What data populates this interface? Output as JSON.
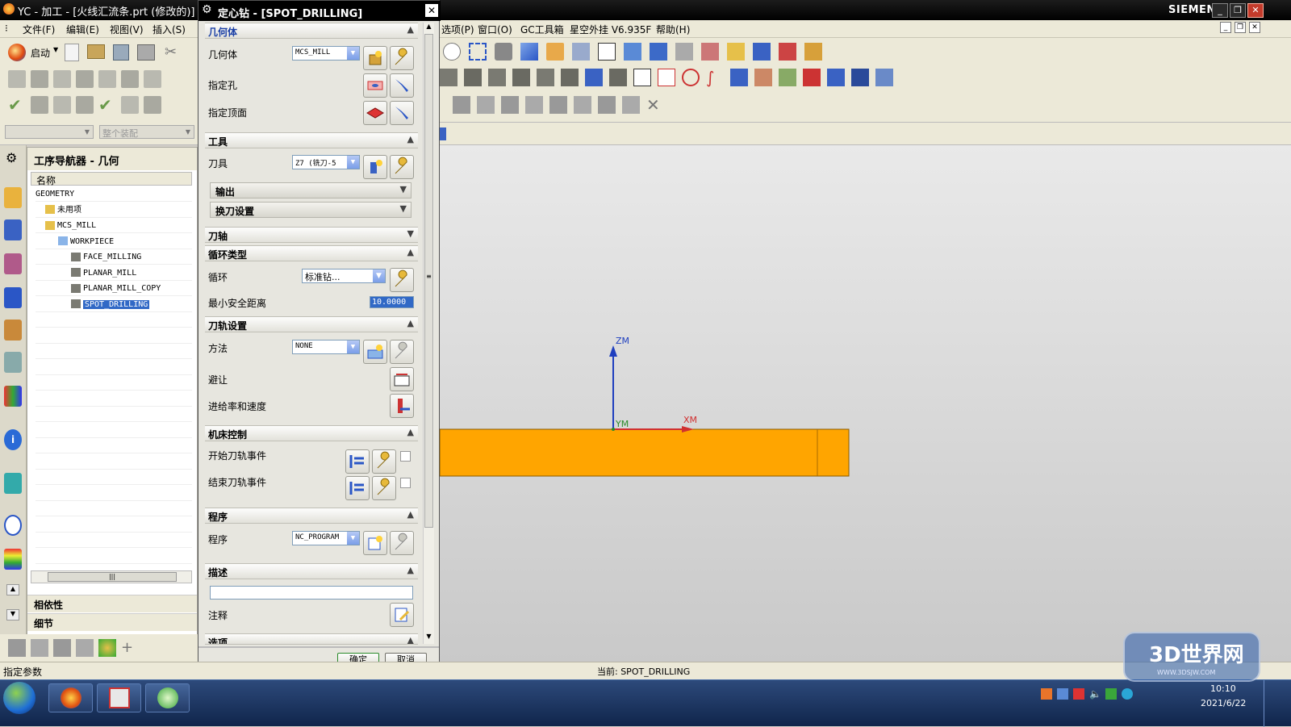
{
  "window": {
    "title": "YC - 加工 - [火线汇流条.prt (修改的)]",
    "brand": "SIEMENS"
  },
  "menu": {
    "left": [
      "文件(F)",
      "编辑(E)",
      "视图(V)",
      "插入(S)"
    ],
    "right": [
      "选项(P)",
      "窗口(O)",
      "GC工具箱",
      "星空外挂 V6.935F",
      "帮助(H)"
    ]
  },
  "toolbar": {
    "start_label": "启动",
    "assembly_placeholder": "整个装配"
  },
  "navigator": {
    "title": "工序导航器 - 几何",
    "column": "名称",
    "rows": [
      {
        "label": "GEOMETRY",
        "indent": 0
      },
      {
        "label": "未用项",
        "indent": 1
      },
      {
        "label": "MCS_MILL",
        "indent": 1
      },
      {
        "label": "WORKPIECE",
        "indent": 2
      },
      {
        "label": "FACE_MILLING",
        "indent": 3
      },
      {
        "label": "PLANAR_MILL",
        "indent": 3
      },
      {
        "label": "PLANAR_MILL_COPY",
        "indent": 3
      },
      {
        "label": "SPOT_DRILLING",
        "indent": 3,
        "selected": true
      }
    ],
    "dependencies": "相依性",
    "details": "细节"
  },
  "dialog": {
    "title": "定心钻 - [SPOT_DRILLING]",
    "geometry": {
      "header": "几何体",
      "geometry_label": "几何体",
      "geometry_value": "MCS_MILL",
      "hole_label": "指定孔",
      "top_label": "指定顶面"
    },
    "tool": {
      "header": "工具",
      "tool_label": "刀具",
      "tool_value": "Z7 (铣刀-5",
      "output": "输出",
      "change": "换刀设置"
    },
    "axis": {
      "header": "刀轴"
    },
    "cycle": {
      "header": "循环类型",
      "cycle_label": "循环",
      "cycle_value": "标准钻...",
      "clearance_label": "最小安全距离",
      "clearance_value": "10.0000"
    },
    "path": {
      "header": "刀轨设置",
      "method_label": "方法",
      "method_value": "NONE",
      "avoid_label": "避让",
      "feed_label": "进给率和速度"
    },
    "machine": {
      "header": "机床控制",
      "start_label": "开始刀轨事件",
      "end_label": "结束刀轨事件"
    },
    "program": {
      "header": "程序",
      "program_label": "程序",
      "program_value": "NC_PROGRAM"
    },
    "description": {
      "header": "描述",
      "note_label": "注释",
      "text_value": ""
    },
    "options": {
      "header": "选项"
    },
    "ok": "确定",
    "cancel": "取消"
  },
  "viewport": {
    "z_axis": "ZM",
    "x_axis": "XM",
    "y_axis": "YM",
    "part_color": "#ffa500"
  },
  "status": {
    "left": "指定参数",
    "center": "当前: SPOT_DRILLING"
  },
  "taskbar": {
    "time": "10:10",
    "date": "2021/6/22",
    "watermark": "3D世界网",
    "watermark_url": "WWW.3DSJW.COM"
  }
}
